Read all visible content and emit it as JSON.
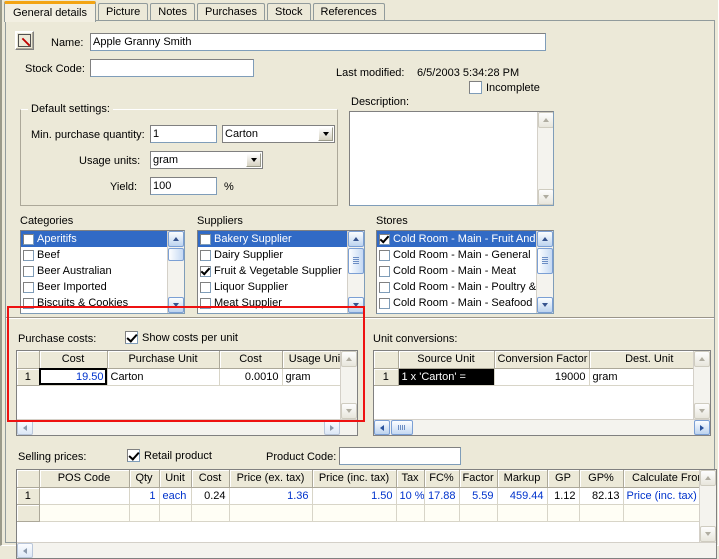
{
  "tabs": [
    {
      "label": "General details",
      "active": true
    },
    {
      "label": "Picture",
      "active": false
    },
    {
      "label": "Notes",
      "active": false
    },
    {
      "label": "Purchases",
      "active": false
    },
    {
      "label": "Stock",
      "active": false
    },
    {
      "label": "References",
      "active": false
    }
  ],
  "general": {
    "name_label": "Name:",
    "name_value": "Apple Granny Smith",
    "stock_code_label": "Stock Code:",
    "stock_code_value": "",
    "last_modified_label": "Last modified:",
    "last_modified_value": "6/5/2003 5:34:28 PM",
    "incomplete_label": "Incomplete",
    "incomplete_checked": false,
    "description_label": "Description:",
    "description_value": "",
    "edit_icon": "pencil-icon"
  },
  "default_settings": {
    "title": "Default settings:",
    "min_qty_label": "Min. purchase quantity:",
    "min_qty_value": "1",
    "min_qty_unit": "Carton",
    "usage_units_label": "Usage units:",
    "usage_units_value": "gram",
    "yield_label": "Yield:",
    "yield_value": "100",
    "yield_suffix": "%"
  },
  "categories": {
    "title": "Categories",
    "items": [
      {
        "label": "Aperitifs",
        "checked": false,
        "selected": true
      },
      {
        "label": "Beef",
        "checked": false,
        "selected": false
      },
      {
        "label": "Beer Australian",
        "checked": false,
        "selected": false
      },
      {
        "label": "Beer Imported",
        "checked": false,
        "selected": false
      },
      {
        "label": "Biscuits & Cookies",
        "checked": false,
        "selected": false
      }
    ]
  },
  "suppliers": {
    "title": "Suppliers",
    "items": [
      {
        "label": "Bakery Supplier",
        "checked": false,
        "selected": true
      },
      {
        "label": "Dairy Supplier",
        "checked": false,
        "selected": false
      },
      {
        "label": "Fruit & Vegetable Supplier",
        "checked": true,
        "selected": false
      },
      {
        "label": "Liquor Supplier",
        "checked": false,
        "selected": false
      },
      {
        "label": "Meat Supplier",
        "checked": false,
        "selected": false
      }
    ]
  },
  "stores": {
    "title": "Stores",
    "items": [
      {
        "label": "Cold Room - Main - Fruit And V",
        "checked": true,
        "selected": true
      },
      {
        "label": "Cold Room - Main - General",
        "checked": false,
        "selected": false
      },
      {
        "label": "Cold Room - Main - Meat",
        "checked": false,
        "selected": false
      },
      {
        "label": "Cold Room - Main - Poultry & G",
        "checked": false,
        "selected": false
      },
      {
        "label": "Cold Room - Main - Seafood",
        "checked": false,
        "selected": false
      }
    ]
  },
  "purchase_costs": {
    "title": "Purchase costs:",
    "show_per_unit_label": "Show costs per unit",
    "show_per_unit_checked": true,
    "columns": [
      "",
      "Cost",
      "Purchase Unit",
      "Cost",
      "Usage Unit",
      ""
    ],
    "rows": [
      {
        "n": "1",
        "cost": "19.50",
        "purchase_unit": "Carton",
        "cost2": "0.0010",
        "usage_unit": "gram"
      }
    ]
  },
  "unit_conversions": {
    "title": "Unit conversions:",
    "columns": [
      "",
      "Source Unit",
      "Conversion Factor",
      "Dest. Unit"
    ],
    "rows": [
      {
        "n": "1",
        "source_unit": "1 x 'Carton' =",
        "factor": "19000",
        "dest_unit": "gram"
      }
    ]
  },
  "selling_prices": {
    "title": "Selling prices:",
    "retail_product_label": "Retail product",
    "retail_product_checked": true,
    "product_code_label": "Product Code:",
    "product_code_value": "",
    "columns": [
      "",
      "POS Code",
      "Qty",
      "Unit",
      "Cost",
      "Price (ex. tax)",
      "Price (inc. tax)",
      "Tax",
      "FC%",
      "Factor",
      "Markup",
      "GP",
      "GP%",
      "Calculate From"
    ],
    "rows": [
      {
        "n": "1",
        "pos_code": "",
        "qty": "1",
        "unit": "each",
        "cost": "0.24",
        "price_ex": "1.36",
        "price_inc": "1.50",
        "tax": "10 %",
        "fc": "17.88",
        "factor": "5.59",
        "markup": "459.44",
        "gp": "1.12",
        "gp_pct": "82.13",
        "calc_from": "Price (inc. tax)"
      }
    ]
  },
  "annotation": {
    "highlight_color": "#ee1111",
    "highlight_target": "purchase-costs-panel"
  }
}
